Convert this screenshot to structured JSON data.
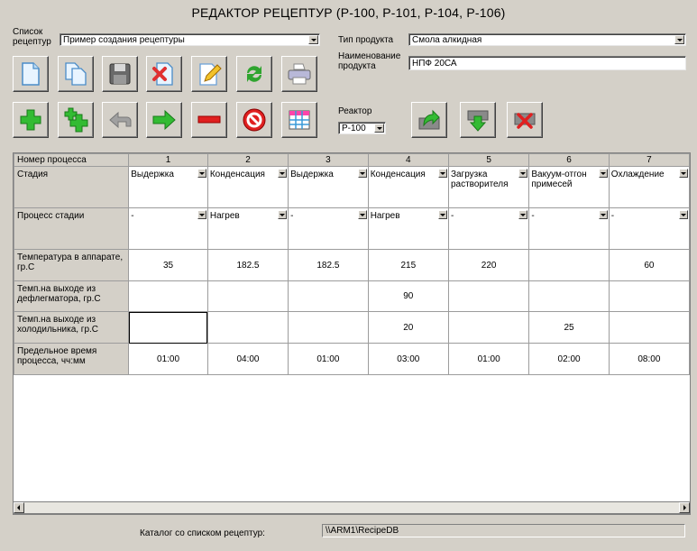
{
  "window": {
    "title": "РЕДАКТОР РЕЦЕПТУР (Р-100, Р-101, Р-104, Р-106)"
  },
  "recipe_list": {
    "label_line1": "Список",
    "label_line2": "рецептур",
    "value": "Пример создания рецептуры"
  },
  "product_type": {
    "label": "Тип продукта",
    "value": "Смола алкидная"
  },
  "product_name": {
    "label_line1": "Наименование",
    "label_line2": "продукта",
    "value": "НПФ 20СА"
  },
  "reactor": {
    "label": "Реактор",
    "value": "Р-100"
  },
  "toolbar_row1": [
    {
      "name": "new-document-icon",
      "color": "#8ec3ea"
    },
    {
      "name": "copy-document-icon",
      "color": "#8ec3ea"
    },
    {
      "name": "save-disk-icon",
      "color": "#777777"
    },
    {
      "name": "delete-document-icon",
      "color": "#e03030"
    },
    {
      "name": "edit-document-icon",
      "color": "#f2c22a"
    },
    {
      "name": "refresh-icon",
      "color": "#2fa42f"
    },
    {
      "name": "print-icon",
      "color": "#9c9cc8"
    }
  ],
  "toolbar_row2": [
    {
      "name": "add-icon",
      "color": "#33bb33"
    },
    {
      "name": "add-multiple-icon",
      "color": "#33bb33"
    },
    {
      "name": "undo-arrow-icon",
      "color": "#a0a0a0"
    },
    {
      "name": "forward-arrow-icon",
      "color": "#33bb33"
    },
    {
      "name": "remove-icon",
      "color": "#e02020"
    },
    {
      "name": "stop-icon",
      "color": "#e02020"
    },
    {
      "name": "table-icon",
      "color": "#ff44aa"
    }
  ],
  "reactor_buttons": [
    {
      "name": "reactor-upload-icon"
    },
    {
      "name": "reactor-download-icon"
    },
    {
      "name": "reactor-delete-icon"
    }
  ],
  "grid": {
    "corner": "Номер процесса",
    "columns": [
      "1",
      "2",
      "3",
      "4",
      "5",
      "6",
      "7"
    ],
    "rows": [
      {
        "header": "Стадия",
        "kind": "select",
        "cells": [
          "Выдержка",
          "Конденсация",
          "Выдержка",
          "Конденсация",
          "Загрузка растворителя",
          "Вакуум-отгон примесей",
          "Охлаждение"
        ]
      },
      {
        "header": "Процесс стадии",
        "kind": "select",
        "cells": [
          "-",
          "Нагрев",
          "-",
          "Нагрев",
          "-",
          "-",
          "-"
        ]
      },
      {
        "header": "Температура в аппарате, гр.С",
        "kind": "num",
        "cells": [
          "35",
          "182.5",
          "182.5",
          "215",
          "220",
          "",
          "60"
        ]
      },
      {
        "header": "Темп.на выходе из дефлегматора, гр.С",
        "kind": "num",
        "cells": [
          "",
          "",
          "",
          "90",
          "",
          "",
          ""
        ]
      },
      {
        "header": "Темп.на выходе из холодильника, гр.С",
        "kind": "num",
        "cells": [
          "",
          "",
          "",
          "20",
          "",
          "25",
          ""
        ]
      },
      {
        "header": "Предельное время процесса, чч:мм",
        "kind": "num",
        "cells": [
          "01:00",
          "04:00",
          "01:00",
          "03:00",
          "01:00",
          "02:00",
          "08:00"
        ]
      }
    ]
  },
  "catalog": {
    "label": "Каталог со списком рецептур:",
    "value": "\\\\ARM1\\RecipeDB"
  }
}
